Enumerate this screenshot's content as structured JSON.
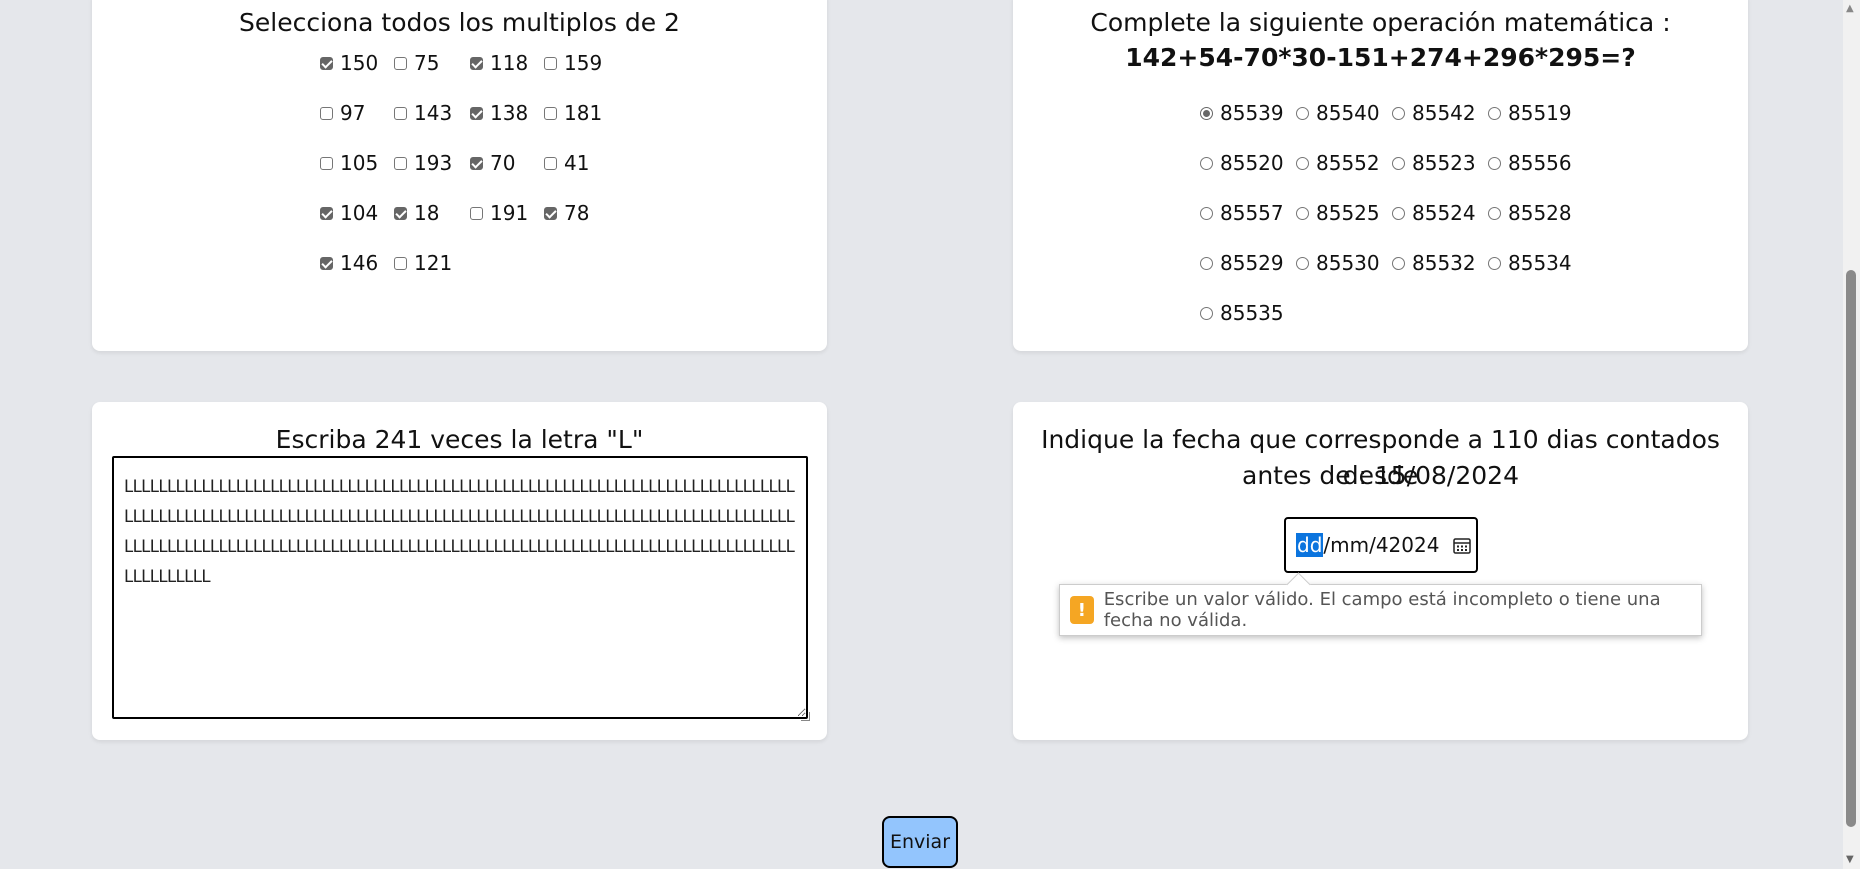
{
  "multiples": {
    "title": "Selecciona todos los multiplos de 2",
    "options": [
      {
        "label": "150",
        "checked": true
      },
      {
        "label": "75",
        "checked": false
      },
      {
        "label": "118",
        "checked": true
      },
      {
        "label": "159",
        "checked": false
      },
      {
        "label": "97",
        "checked": false
      },
      {
        "label": "143",
        "checked": false
      },
      {
        "label": "138",
        "checked": true
      },
      {
        "label": "181",
        "checked": false
      },
      {
        "label": "105",
        "checked": false
      },
      {
        "label": "193",
        "checked": false
      },
      {
        "label": "70",
        "checked": true
      },
      {
        "label": "41",
        "checked": false
      },
      {
        "label": "104",
        "checked": true
      },
      {
        "label": "18",
        "checked": true
      },
      {
        "label": "191",
        "checked": false
      },
      {
        "label": "78",
        "checked": true
      },
      {
        "label": "146",
        "checked": true
      },
      {
        "label": "121",
        "checked": false
      }
    ]
  },
  "math": {
    "title": "Complete la siguiente operación matemática :",
    "expression": "142+54-70*30-151+274+296*295=?",
    "options": [
      {
        "label": "85539",
        "selected": true
      },
      {
        "label": "85540",
        "selected": false
      },
      {
        "label": "85542",
        "selected": false
      },
      {
        "label": "85519",
        "selected": false
      },
      {
        "label": "85520",
        "selected": false
      },
      {
        "label": "85552",
        "selected": false
      },
      {
        "label": "85523",
        "selected": false
      },
      {
        "label": "85556",
        "selected": false
      },
      {
        "label": "85557",
        "selected": false
      },
      {
        "label": "85525",
        "selected": false
      },
      {
        "label": "85524",
        "selected": false
      },
      {
        "label": "85528",
        "selected": false
      },
      {
        "label": "85529",
        "selected": false
      },
      {
        "label": "85530",
        "selected": false
      },
      {
        "label": "85532",
        "selected": false
      },
      {
        "label": "85534",
        "selected": false
      },
      {
        "label": "85535",
        "selected": false
      }
    ]
  },
  "letters": {
    "title": "Escriba 241 veces la letra \"L\"",
    "value": "LLLLLLLLLLLLLLLLLLLLLLLLLLLLLLLLLLLLLLLLLLLLLLLLLLLLLLLLLLLLLLLLLLLLLLLLLLLLLLLLLLLLLLLLLLLLLLLLLLLLLLLLLLLLLLLLLLLLLLLLLLLLLLLLLLLLLLLLLLLLLLLLLLLLLLLLLLLLLLLLLLLLLLLLLLLLLLLLLLLLLLLLLLLLLLLLLLLLLLLLLLLLLLLLLLLLLLLLLLLLLLLLLLLLLLLLLLLLLLLLLLLL"
  },
  "date": {
    "title_line1": "Indique la fecha que corresponde a 110 dias contados desde",
    "title_line2": "antes de : 15/08/2024",
    "input_day": "dd",
    "input_rest": "/mm/42024",
    "tooltip_icon": "!",
    "tooltip": "Escribe un valor válido. El campo está incompleto o tiene una fecha no válida."
  },
  "submit_label": "Enviar",
  "colors": {
    "background": "#e5e7eb",
    "submit": "#93c5fd",
    "selection": "#0b74de",
    "warning": "#f5a623"
  }
}
